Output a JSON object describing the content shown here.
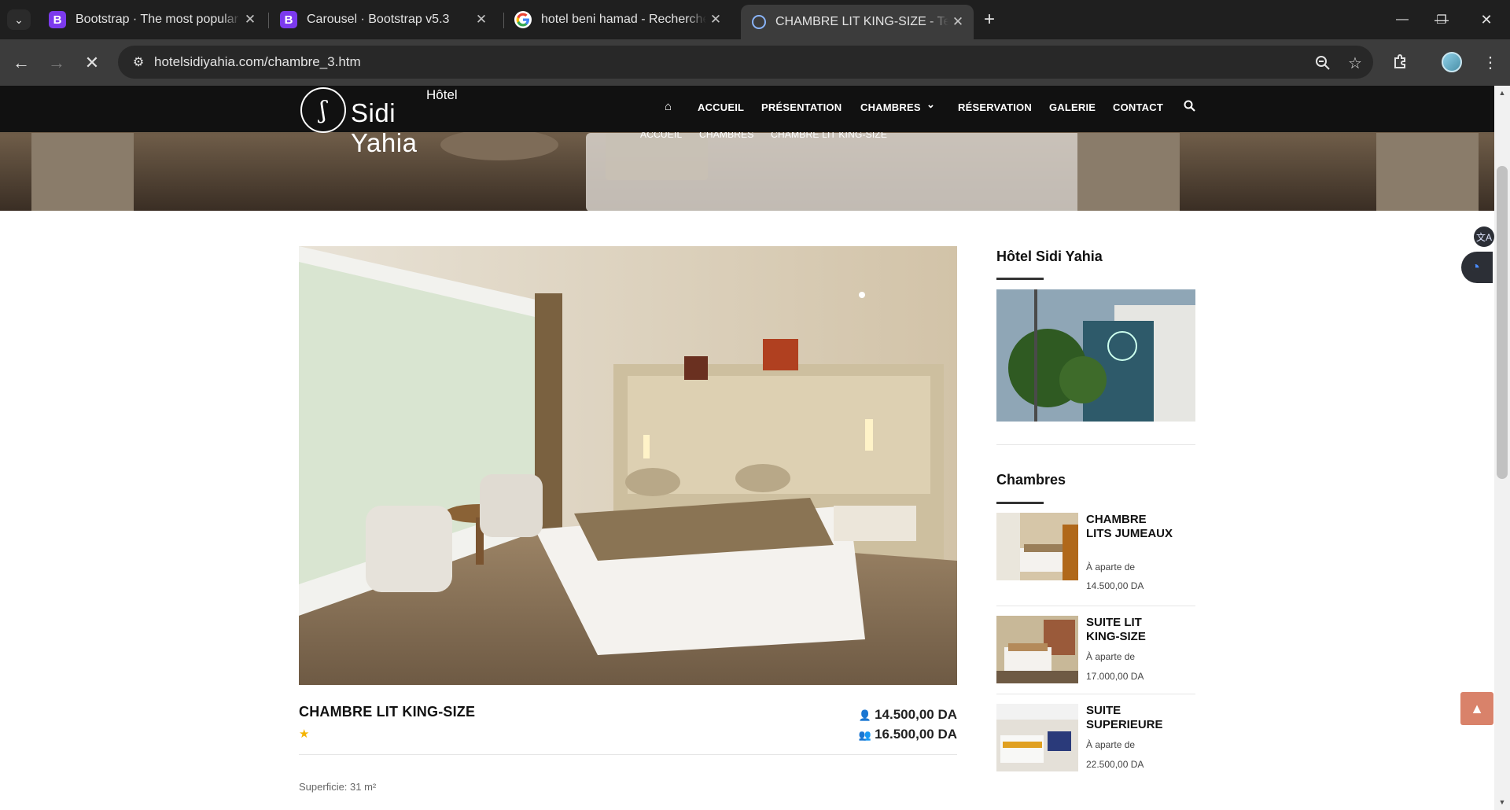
{
  "browser": {
    "tabs": [
      {
        "title": "Bootstrap · The most popular HTML, CSS, and JS library",
        "favicon": "B",
        "favicon_color": "#7c3aed"
      },
      {
        "title": "Carousel · Bootstrap v5.3",
        "favicon": "B",
        "favicon_color": "#7c3aed"
      },
      {
        "title": "hotel beni hamad - Recherche Google",
        "favicon": "G",
        "favicon_color": "#ffffff"
      },
      {
        "title": "CHAMBRE LIT KING-SIZE - Template",
        "favicon": "loading",
        "favicon_color": "#8ab4f8"
      }
    ],
    "url": "hotelsidiyahia.com/chambre_3.htm"
  },
  "site": {
    "logo_hotel": "Hôtel",
    "logo_brand": "Sidi Yahia",
    "logo_mark": "ʃ",
    "nav": {
      "home_icon": "home-icon",
      "items": [
        "ACCUEIL",
        "PRÉSENTATION",
        "CHAMBRES",
        "RÉSERVATION",
        "GALERIE",
        "CONTACT"
      ],
      "chevron": "⌄"
    },
    "breadcrumb": [
      "ACCUEIL",
      "CHAMBRES",
      "CHAMBRE LIT KING-SIZE"
    ]
  },
  "room": {
    "title": "CHAMBRE LIT KING-SIZE",
    "stars": "★",
    "price_single": "14.500,00 DA",
    "price_double": "16.500,00 DA",
    "superficie": "Superficie: 31 m²"
  },
  "sidebar": {
    "hotel_title": "Hôtel Sidi Yahia",
    "rooms_title": "Chambres",
    "rooms": [
      {
        "name": "CHAMBRE LITS JUMEAUX",
        "from": "À aparte de",
        "price": "14.500,00 DA"
      },
      {
        "name": "SUITE LIT KING-SIZE",
        "from": "À aparte de",
        "price": "17.000,00 DA"
      },
      {
        "name": "SUITE SUPERIEURE",
        "from": "À aparte de",
        "price": "22.500,00 DA"
      }
    ]
  },
  "colors": {
    "nav_bg": "#111111",
    "accent_totop": "#d9826a",
    "star": "#f5b400"
  }
}
